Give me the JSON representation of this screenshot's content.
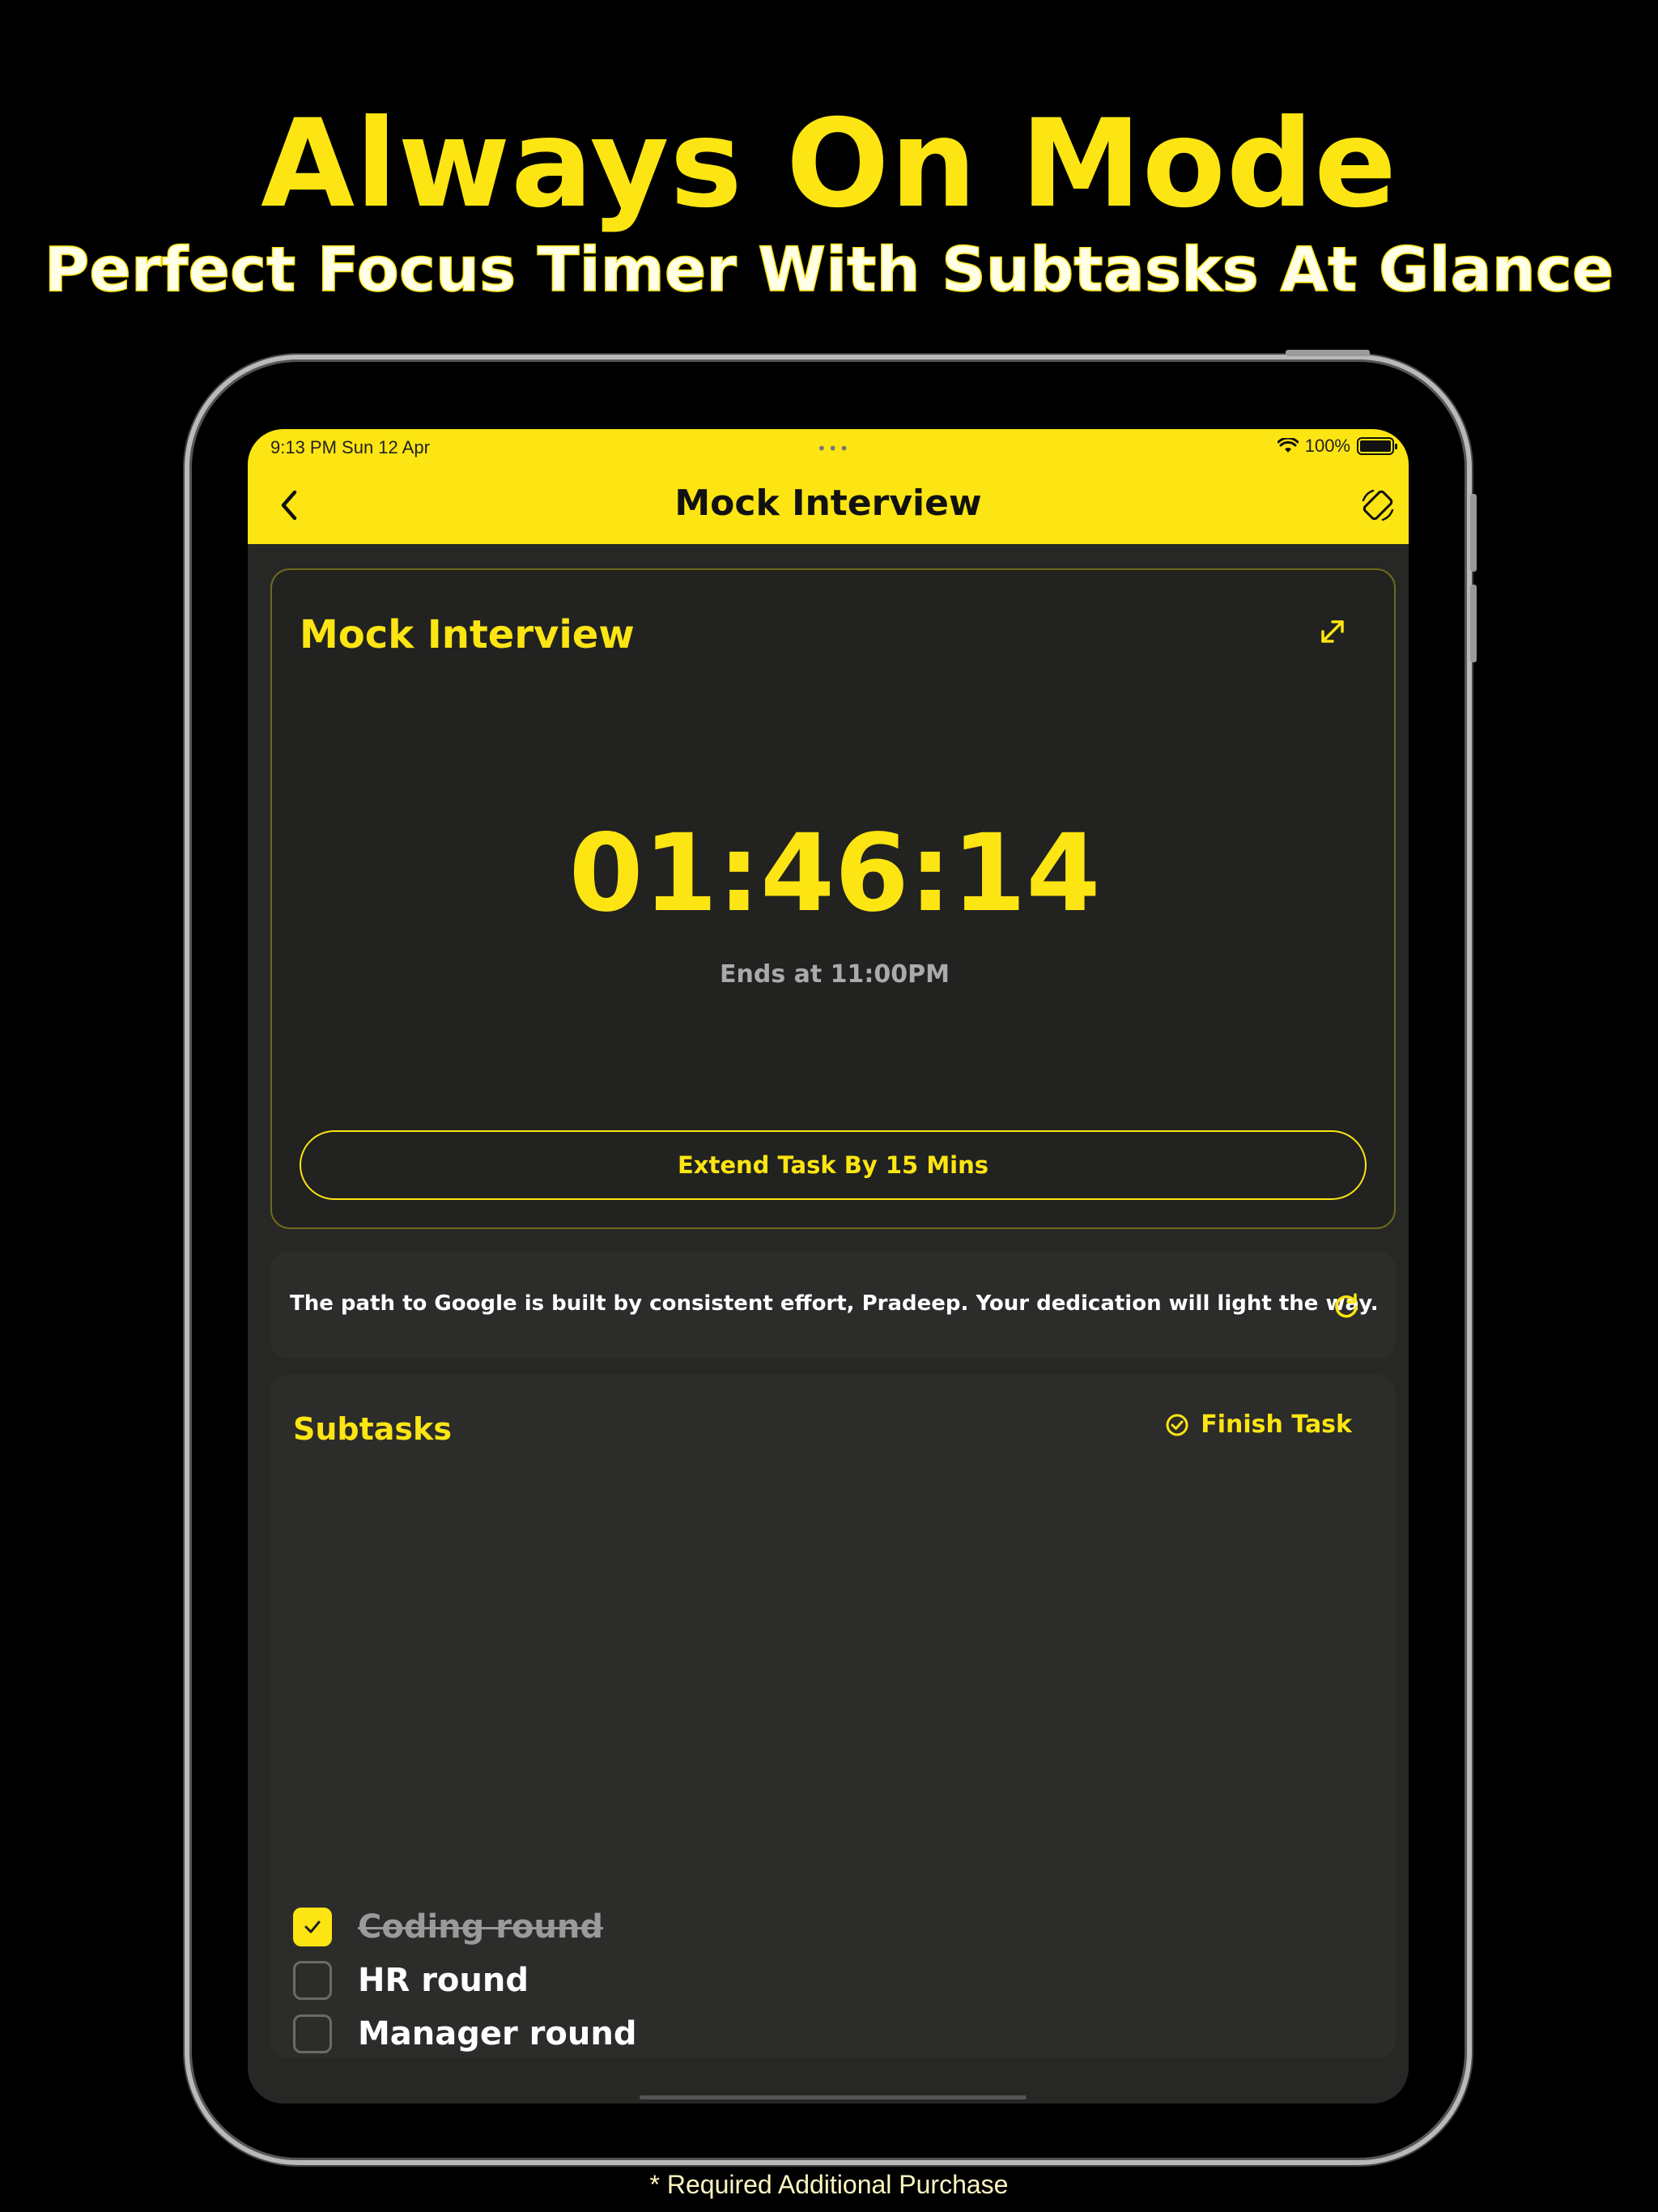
{
  "promo": {
    "headline": "Always On Mode",
    "subheadline": "Perfect Focus Timer With Subtasks At Glance",
    "footnote": "* Required Additional Purchase"
  },
  "status_bar": {
    "time_date": "9:13 PM   Sun 12 Apr",
    "dots": "•••",
    "battery": "100%"
  },
  "nav": {
    "title": "Mock Interview",
    "back_icon": "chevron-left-icon",
    "rotate_icon": "rotate-screen-icon"
  },
  "timer_card": {
    "title": "Mock Interview",
    "timer": "01:46:14",
    "ends_at": "Ends at 11:00PM",
    "extend_label": "Extend Task By 15 Mins",
    "expand_icon": "expand-icon"
  },
  "quote": {
    "text": "The path to Google is built by consistent effort, Pradeep. Your dedication will light the way.",
    "refresh_icon": "refresh-icon"
  },
  "subtasks": {
    "title": "Subtasks",
    "finish_label": "Finish Task",
    "items": [
      {
        "label": "Coding round",
        "done": true
      },
      {
        "label": "HR round",
        "done": false
      },
      {
        "label": "Manager round",
        "done": false
      }
    ]
  },
  "colors": {
    "accent": "#FCE512",
    "background": "#000000",
    "card": "#2c2c2a"
  }
}
